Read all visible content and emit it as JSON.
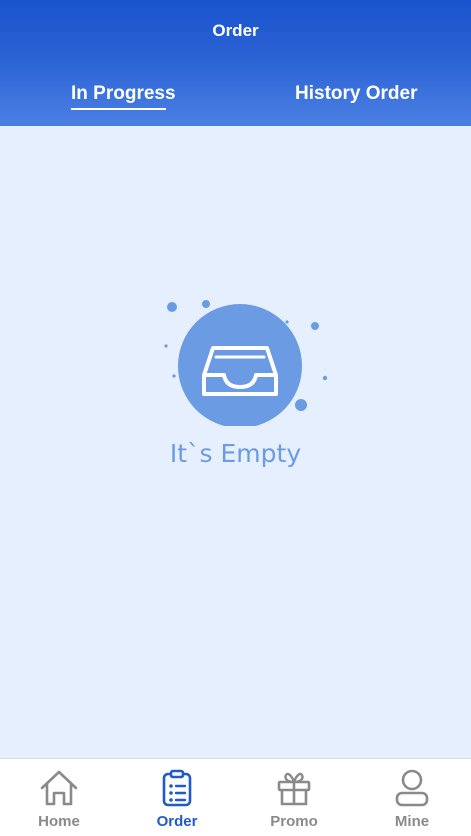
{
  "header": {
    "title": "Order",
    "tabs": [
      {
        "label": "In Progress",
        "active": true
      },
      {
        "label": "History Order",
        "active": false
      }
    ]
  },
  "empty_state": {
    "message": "It`s Empty",
    "icon": "empty-inbox-tray-icon"
  },
  "bottom_nav": {
    "items": [
      {
        "label": "Home",
        "icon": "home-icon",
        "active": false
      },
      {
        "label": "Order",
        "icon": "clipboard-list-icon",
        "active": true
      },
      {
        "label": "Promo",
        "icon": "gift-icon",
        "active": false
      },
      {
        "label": "Mine",
        "icon": "user-icon",
        "active": false
      }
    ]
  },
  "colors": {
    "header_top": "#1a54cd",
    "header_bottom": "#4b80e3",
    "background": "#e6effd",
    "accent": "#1f5bc9",
    "empty_icon": "#6b9be2",
    "inactive_nav": "#8a8a8a"
  }
}
